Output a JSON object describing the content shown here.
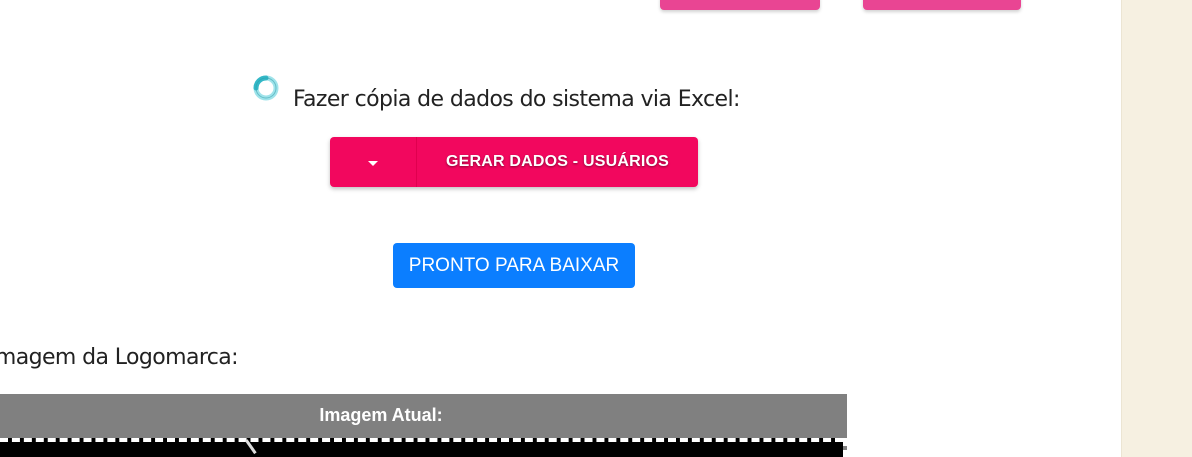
{
  "export_section": {
    "heading": "Fazer cópia de dados do sistema via Excel:",
    "generate_button_label": "GERAR DADOS - USUÁRIOS",
    "ready_button_label": "PRONTO PARA BAIXAR"
  },
  "logo_section": {
    "heading": "Imagem da Logomarca:",
    "current_image_label": "Imagem Atual:"
  },
  "colors": {
    "primary_pink": "#f2075e",
    "top_button_pink": "#e94593",
    "download_blue": "#0b7eff",
    "panel_gray": "#808080",
    "sidebar_beige": "#f6f0e1"
  },
  "icons": {
    "loader": "loading-spinner-icon",
    "dropdown": "caret-down-icon"
  }
}
